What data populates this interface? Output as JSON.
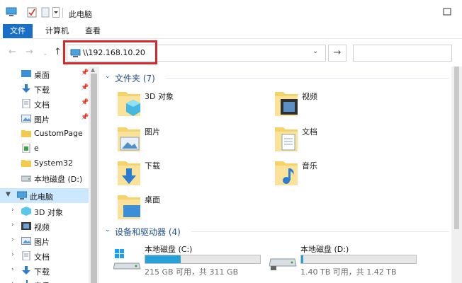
{
  "window": {
    "title": "此电脑"
  },
  "ribbon": {
    "tabs": [
      "文件",
      "计算机",
      "查看"
    ]
  },
  "address": {
    "value": "\\\\192.168.10.20"
  },
  "nav_pane": {
    "items": [
      {
        "label": "桌面",
        "icon": "desktop-icon",
        "pinned": true
      },
      {
        "label": "下载",
        "icon": "download-icon",
        "pinned": true
      },
      {
        "label": "文档",
        "icon": "document-icon",
        "pinned": true
      },
      {
        "label": "图片",
        "icon": "picture-icon",
        "pinned": true
      },
      {
        "label": "CustomPage",
        "icon": "folder-icon",
        "pinned": false
      },
      {
        "label": "e",
        "icon": "green-folder-icon",
        "pinned": false
      },
      {
        "label": "System32",
        "icon": "folder-icon",
        "pinned": false
      },
      {
        "label": "本地磁盘 (D:)",
        "icon": "drive-icon",
        "pinned": false
      },
      {
        "label": "此电脑",
        "icon": "computer-icon",
        "pinned": false,
        "selected": true,
        "expanded": true
      },
      {
        "label": "3D 对象",
        "icon": "3d-objects-icon",
        "pinned": false
      },
      {
        "label": "视频",
        "icon": "video-icon",
        "pinned": false
      },
      {
        "label": "图片",
        "icon": "picture-icon",
        "pinned": false
      },
      {
        "label": "文档",
        "icon": "document-icon",
        "pinned": false
      },
      {
        "label": "下载",
        "icon": "download-icon",
        "pinned": false
      },
      {
        "label": "音乐",
        "icon": "music-icon",
        "pinned": false
      }
    ]
  },
  "content": {
    "folders_group": "文件夹 (7)",
    "folders": [
      {
        "label": "3D 对象",
        "icon": "3d-objects-folder-icon"
      },
      {
        "label": "视频",
        "icon": "video-folder-icon"
      },
      {
        "label": "图片",
        "icon": "pictures-folder-icon"
      },
      {
        "label": "文档",
        "icon": "documents-folder-icon"
      },
      {
        "label": "下载",
        "icon": "downloads-folder-icon"
      },
      {
        "label": "音乐",
        "icon": "music-folder-icon"
      },
      {
        "label": "桌面",
        "icon": "desktop-folder-icon"
      }
    ],
    "drives_group": "设备和驱动器 (4)",
    "drives": [
      {
        "name": "本地磁盘 (C:)",
        "info": "215 GB 可用，共 311 GB",
        "used_fraction": 0.31,
        "icon": "windows-drive-icon"
      },
      {
        "name": "本地磁盘 (D:)",
        "info": "1.40 TB 可用，共 1.42 TB",
        "used_fraction": 0.02,
        "icon": "drive-icon"
      }
    ]
  },
  "colors": {
    "accent": "#1a6fc4",
    "highlight_box": "#d7262c",
    "drive_bar": "#26a0da",
    "selection": "#cce8ff",
    "group_header": "#1e4e8c"
  }
}
